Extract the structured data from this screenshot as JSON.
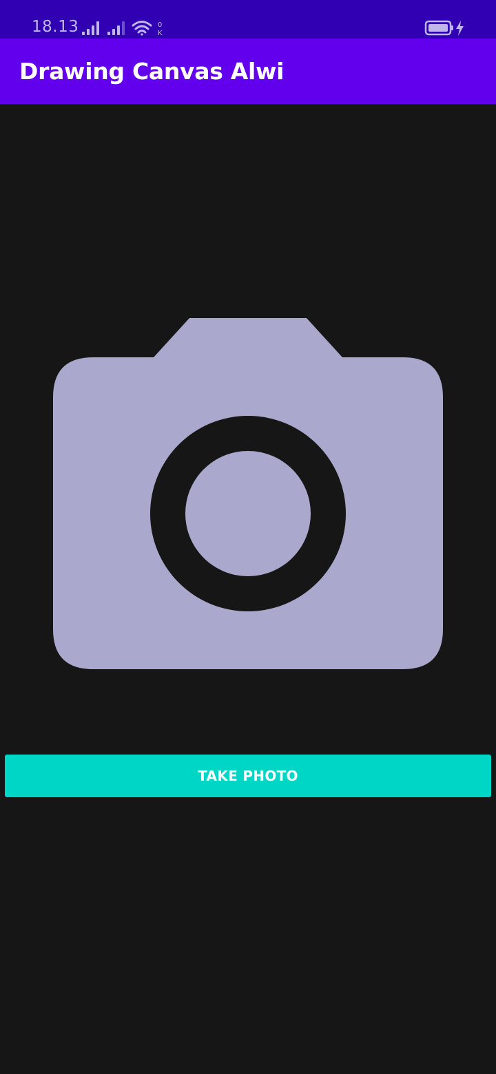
{
  "status_bar": {
    "time": "18.13",
    "signal_1_icon": "cellular-signal-icon",
    "signal_2_icon": "cellular-signal-icon",
    "wifi_icon": "wifi-icon",
    "data_speed_text": "0 K",
    "battery_icon": "battery-charging-icon",
    "background_color": "#3000b2"
  },
  "app_bar": {
    "title": "Drawing Canvas Alwi",
    "background_color": "#6200ed"
  },
  "main": {
    "image_placeholder_icon": "camera-icon",
    "image_placeholder_color": "#aaa8cd",
    "take_photo_label": "TAKE PHOTO",
    "button_color": "#00d6c6",
    "background_color": "#161616"
  }
}
